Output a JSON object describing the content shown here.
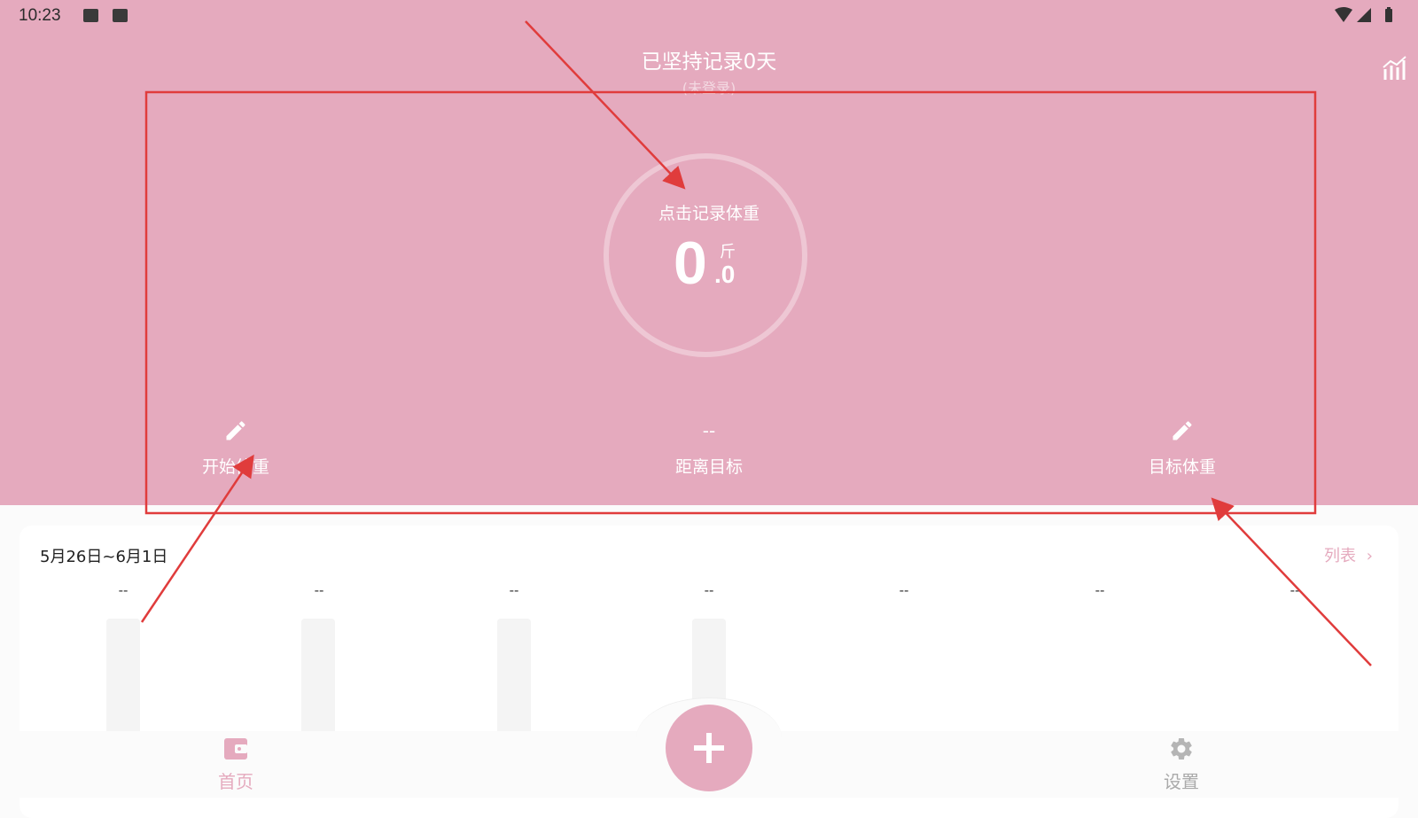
{
  "status_bar": {
    "time": "10:23"
  },
  "header": {
    "title": "已坚持记录0天",
    "subtitle": "(未登录)",
    "chart_icon": "chart-icon",
    "background": "#e5aabe"
  },
  "weight": {
    "prompt": "点击记录体重",
    "integer": "0",
    "decimal": ".0",
    "unit": "斤"
  },
  "stats": {
    "start": {
      "icon": "pencil-icon",
      "label": "开始体重"
    },
    "distance": {
      "value": "--",
      "label": "距离目标"
    },
    "target": {
      "icon": "pencil-icon",
      "label": "目标体重"
    }
  },
  "week": {
    "range": "5月26日~6月1日",
    "list_label": "列表",
    "values": [
      "--",
      "--",
      "--",
      "--",
      "--",
      "--",
      "--"
    ]
  },
  "nav": {
    "home": {
      "label": "首页",
      "icon": "wallet-icon"
    },
    "add": {
      "icon": "plus-icon"
    },
    "settings": {
      "label": "设置",
      "icon": "gear-icon"
    }
  }
}
